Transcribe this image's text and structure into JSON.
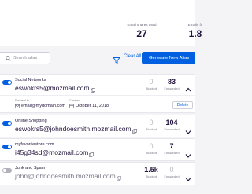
{
  "stats": {
    "emails_blocked_label": "Email shares used",
    "emails_blocked_value": "27",
    "emails_forwarded_label": "Emails fo",
    "emails_forwarded_value": "1.8"
  },
  "toolbar": {
    "search_placeholder": "Search alias",
    "clear_all_label": "Clear All",
    "generate_label": "Generate New Alias"
  },
  "aliases": [
    {
      "label": "Social Networks",
      "address": "eswokrs5@mozmail.com",
      "enabled": true,
      "blocked": "0",
      "blocked_label": "Blocked",
      "forwarded": "83",
      "forwarded_label": "Forwarded",
      "expanded": true,
      "forwarded_to_label": "Forward to",
      "forwarded_to": "email@mydomain.com",
      "created_label": "Created",
      "created": "October 11, 2018",
      "delete_label": "Delete"
    },
    {
      "label": "Online Shopping",
      "address": "eswokrs5@johndoesmith.mozmail.com",
      "enabled": true,
      "blocked": "0",
      "blocked_label": "Blocked",
      "forwarded": "104",
      "forwarded_label": "Forwarded"
    },
    {
      "label": "myfavoritestore.com",
      "address": "i45g34sd@mozmail.com",
      "enabled": true,
      "blocked": "0",
      "blocked_label": "Blocked",
      "forwarded": "7",
      "forwarded_label": "Forwarded"
    },
    {
      "label": "Junk and Spam",
      "address": "john@johndoesmith.mozmail.com",
      "enabled": false,
      "blocked": "1.5k",
      "blocked_label": "Blocked",
      "forwarded": "0",
      "forwarded_label": "Forwarded"
    }
  ]
}
